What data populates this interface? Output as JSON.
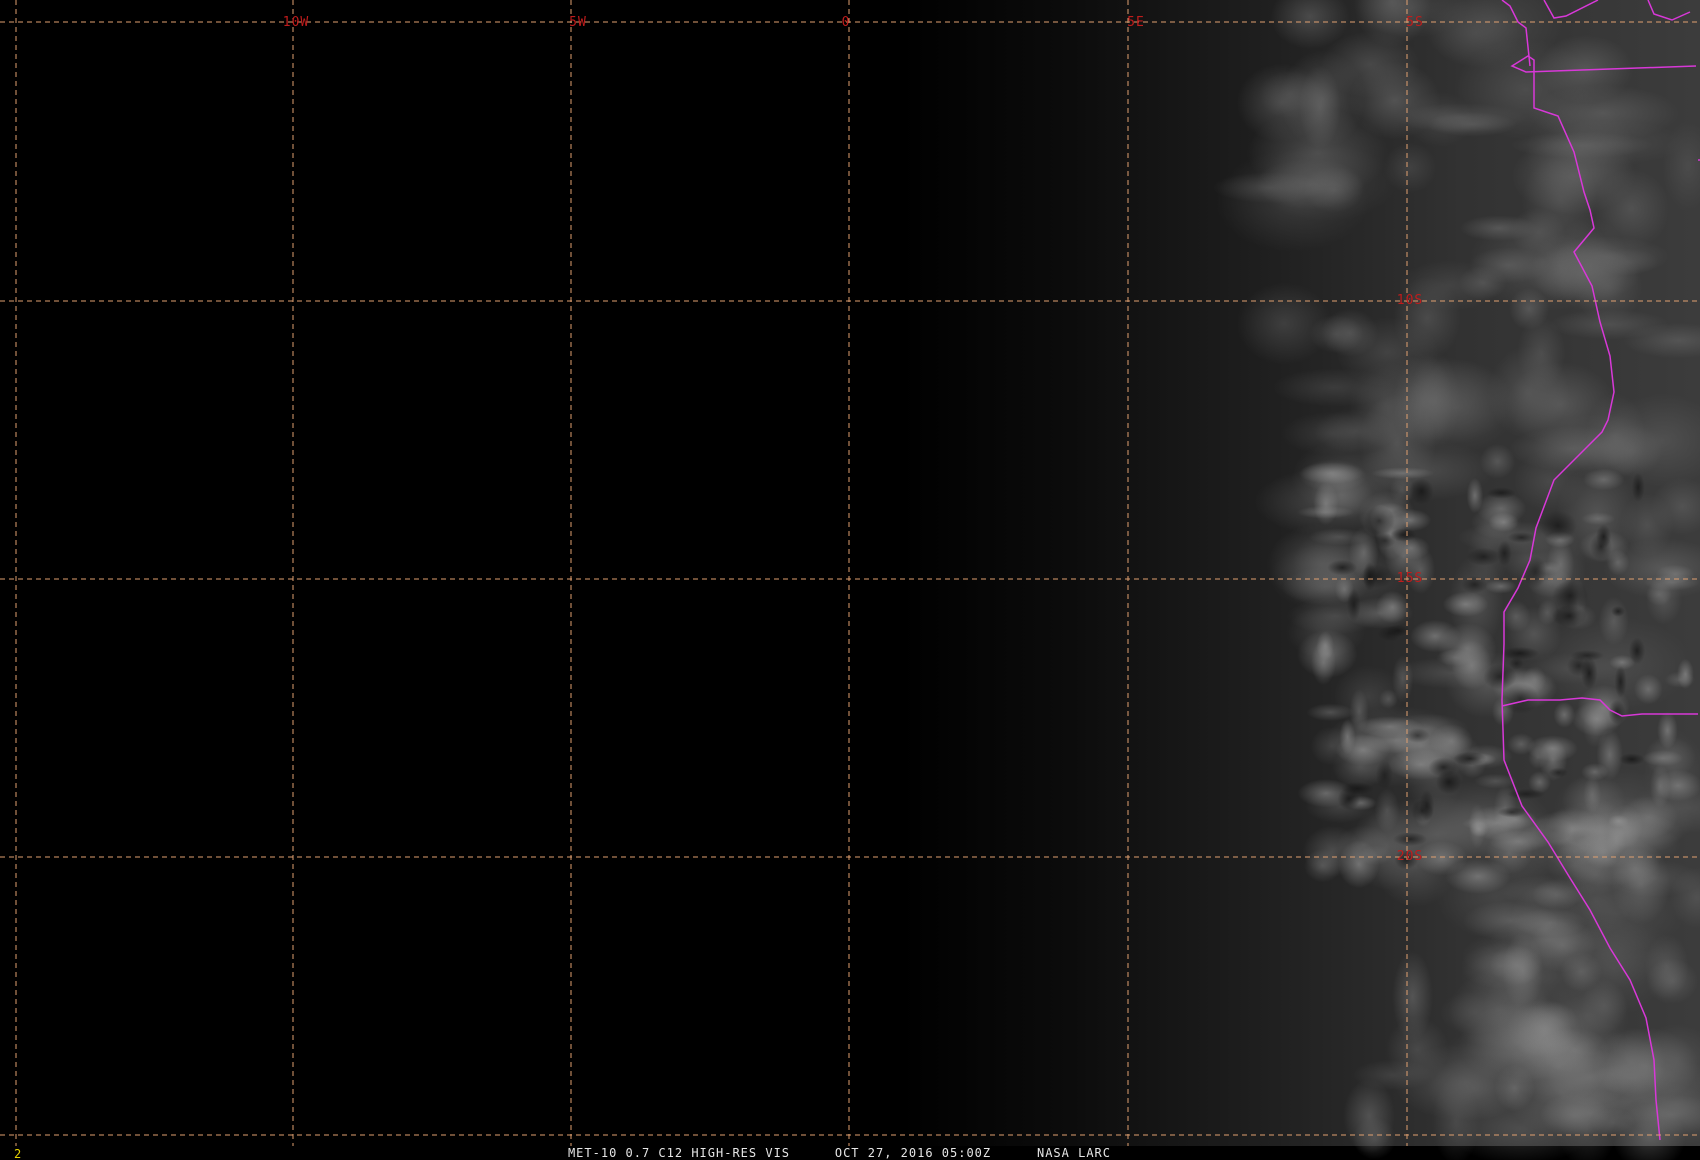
{
  "colors": {
    "background": "#000000",
    "graticule": "#e0a070",
    "grid_label": "#c01c1c",
    "border": "#d838d8",
    "caption_text": "#e6e6e6",
    "frame_text": "#e6d200"
  },
  "graticule": {
    "longitude_labels": [
      "10W",
      "5W",
      "0",
      "5E",
      "5S"
    ],
    "latitude_labels": [
      "10S",
      "15S",
      "20S"
    ]
  },
  "caption": {
    "frame_number": "2",
    "product": "MET-10 0.7 C12 HIGH-RES VIS",
    "timestamp": "OCT 27, 2016 05:00Z",
    "source": "NASA LARC"
  },
  "icons": [
    "satellite-imagery",
    "coastline",
    "political-border"
  ]
}
